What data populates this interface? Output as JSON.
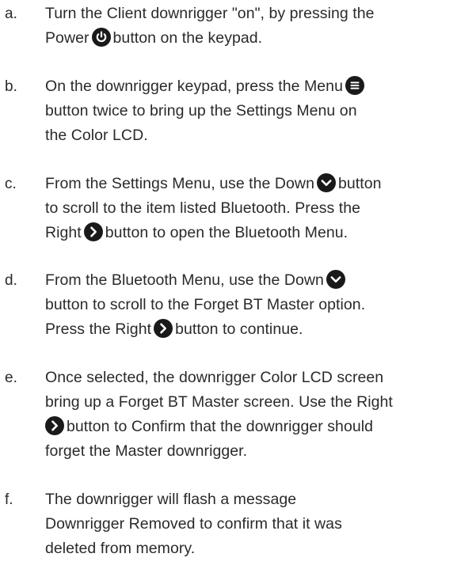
{
  "steps": [
    {
      "letter": "a.",
      "line1_pre": "Turn the Client downrigger \"on\", by pressing the",
      "line2_pre": "Power",
      "icon": "power-icon",
      "line2_post": "button on the keypad."
    },
    {
      "letter": "b.",
      "line1_pre": "On the downrigger keypad, press the Menu",
      "icon": "menu-icon",
      "line2": "button twice to bring up the Settings Menu on",
      "line3": "the Color LCD."
    },
    {
      "letter": "c.",
      "line1_pre": "From the Settings Menu, use the Down",
      "icon1": "down-chevron-icon",
      "line1_post": "button",
      "line2": "to scroll to the item listed Bluetooth. Press the",
      "line3_pre": "Right",
      "icon2": "right-chevron-icon",
      "line3_post": "button to open the Bluetooth Menu."
    },
    {
      "letter": "d.",
      "line1_pre": "From the Bluetooth Menu, use the Down",
      "icon1": "down-chevron-icon",
      "line2": "button to scroll to the Forget BT Master option.",
      "line3_pre": "Press the Right",
      "icon2": "right-chevron-icon",
      "line3_post": "button to continue."
    },
    {
      "letter": "e.",
      "line1": "Once selected, the downrigger Color LCD screen",
      "line2": "bring up a Forget BT Master screen. Use the Right",
      "icon": "right-chevron-icon",
      "line3_post": "button to Confirm that the downrigger should",
      "line4": "forget the Master downrigger."
    },
    {
      "letter": "f.",
      "line1": "The downrigger will flash a message",
      "line2": "Downrigger Removed to confirm that it was",
      "line3": "deleted from memory."
    }
  ],
  "colors": {
    "text": "#2a2a2a",
    "icon": "#1a1a1a"
  }
}
